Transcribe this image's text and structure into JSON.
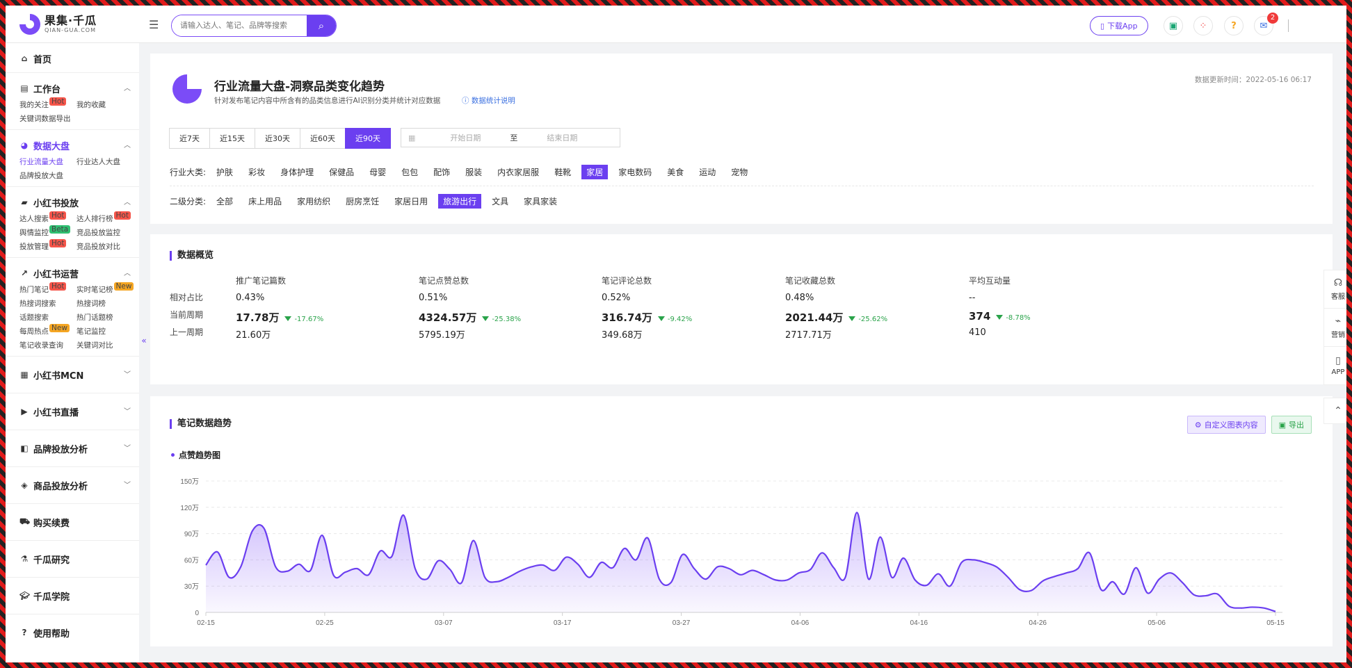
{
  "header": {
    "logo_cn": "果集·千瓜",
    "logo_en": "QIAN-GUA.COM",
    "search_placeholder": "请输入达人、笔记、品牌等搜索",
    "download_app": "下载App",
    "message_count": "2"
  },
  "sidebar": {
    "home": "首页",
    "workbench": {
      "title": "工作台",
      "items": [
        {
          "label": "我的关注",
          "tag": "Hot"
        },
        {
          "label": "我的收藏",
          "tag": ""
        },
        {
          "label": "关键词数据导出",
          "tag": ""
        }
      ]
    },
    "data_board": {
      "title": "数据大盘",
      "items": [
        {
          "label": "行业流量大盘",
          "tag": ""
        },
        {
          "label": "行业达人大盘",
          "tag": ""
        },
        {
          "label": "品牌投放大盘",
          "tag": ""
        }
      ]
    },
    "xhs_ads": {
      "title": "小红书投放",
      "items": [
        {
          "label": "达人搜索",
          "tag": "Hot"
        },
        {
          "label": "达人排行榜",
          "tag": "Hot"
        },
        {
          "label": "舆情监控",
          "tag": "Beta"
        },
        {
          "label": "竞品投放监控",
          "tag": ""
        },
        {
          "label": "投放管理",
          "tag": "Hot"
        },
        {
          "label": "竞品投放对比",
          "tag": ""
        }
      ]
    },
    "xhs_ops": {
      "title": "小红书运营",
      "items": [
        {
          "label": "热门笔记",
          "tag": "Hot"
        },
        {
          "label": "实时笔记榜",
          "tag": "New"
        },
        {
          "label": "热搜词搜索",
          "tag": ""
        },
        {
          "label": "热搜词榜",
          "tag": ""
        },
        {
          "label": "话题搜索",
          "tag": ""
        },
        {
          "label": "热门话题榜",
          "tag": ""
        },
        {
          "label": "每周热点",
          "tag": "New"
        },
        {
          "label": "笔记监控",
          "tag": ""
        },
        {
          "label": "笔记收录查询",
          "tag": ""
        },
        {
          "label": "关键词对比",
          "tag": ""
        }
      ]
    },
    "xhs_mcn": "小红书MCN",
    "xhs_live": "小红书直播",
    "brand_analysis": "品牌投放分析",
    "product_analysis": "商品投放分析",
    "purchase": "购买续费",
    "research": "千瓜研究",
    "academy": "千瓜学院",
    "help": "使用帮助"
  },
  "page": {
    "title": "行业流量大盘-洞察品类变化趋势",
    "desc": "针对发布笔记内容中所含有的品类信息进行AI识别分类并统计对应数据",
    "stat_link": "数据统计说明",
    "update_time": "数据更新时间：2022-05-16 06:17",
    "ranges": [
      "近7天",
      "近15天",
      "近30天",
      "近60天",
      "近90天"
    ],
    "active_range": "近90天",
    "date_start_placeholder": "开始日期",
    "date_to": "至",
    "date_end_placeholder": "结束日期",
    "industry_label": "行业大类:",
    "industries": [
      "护肤",
      "彩妆",
      "身体护理",
      "保健品",
      "母婴",
      "包包",
      "配饰",
      "服装",
      "内衣家居服",
      "鞋靴",
      "家居",
      "家电数码",
      "美食",
      "运动",
      "宠物"
    ],
    "active_industry": "家居",
    "sub_label": "二级分类:",
    "subs": [
      "全部",
      "床上用品",
      "家用纺织",
      "厨房烹饪",
      "家居日用",
      "旅游出行",
      "文具",
      "家具家装"
    ],
    "active_sub": "旅游出行"
  },
  "overview": {
    "title": "数据概览",
    "row_labels": [
      "相对占比",
      "当前周期",
      "上一周期"
    ],
    "columns": [
      {
        "head": "推广笔记篇数",
        "ratio": "0.43%",
        "current": "17.78万",
        "change": "-17.67%",
        "prev": "21.60万"
      },
      {
        "head": "笔记点赞总数",
        "ratio": "0.51%",
        "current": "4324.57万",
        "change": "-25.38%",
        "prev": "5795.19万"
      },
      {
        "head": "笔记评论总数",
        "ratio": "0.52%",
        "current": "316.74万",
        "change": "-9.42%",
        "prev": "349.68万"
      },
      {
        "head": "笔记收藏总数",
        "ratio": "0.48%",
        "current": "2021.44万",
        "change": "-25.62%",
        "prev": "2717.71万"
      },
      {
        "head": "平均互动量",
        "ratio": "--",
        "current": "374",
        "change": "-8.78%",
        "prev": "410"
      }
    ]
  },
  "trend": {
    "title": "笔记数据趋势",
    "custom_btn": "自定义图表内容",
    "export_btn": "导出",
    "subtitle": "点赞趋势图"
  },
  "float_bar": {
    "service": "客服",
    "marketing": "营销",
    "app": "APP"
  },
  "colors": {
    "accent": "#6b3ff0",
    "down": "#2aa34a",
    "hot": "#f5554a"
  },
  "chart_data": {
    "type": "area",
    "ylim": [
      0,
      1500000
    ],
    "yticks": [
      "0",
      "30万",
      "60万",
      "90万",
      "120万",
      "150万"
    ],
    "ytick_values": [
      0,
      300000,
      600000,
      900000,
      1200000,
      1500000
    ],
    "xticks": [
      "02-15",
      "02-25",
      "03-07",
      "03-17",
      "03-27",
      "04-06",
      "04-16",
      "04-26",
      "05-06",
      "05-15"
    ],
    "x_start": "2022-02-15",
    "x_end": "2022-05-15",
    "series": [
      {
        "values": [
          540000,
          690000,
          400000,
          520000,
          930000,
          960000,
          520000,
          470000,
          550000,
          480000,
          880000,
          420000,
          460000,
          500000,
          430000,
          700000,
          640000,
          1110000,
          500000,
          380000,
          590000,
          490000,
          340000,
          820000,
          400000,
          350000,
          400000,
          470000,
          520000,
          540000,
          480000,
          630000,
          550000,
          400000,
          570000,
          510000,
          730000,
          600000,
          850000,
          380000,
          340000,
          660000,
          500000,
          380000,
          520000,
          500000,
          430000,
          480000,
          430000,
          370000,
          370000,
          450000,
          490000,
          680000,
          510000,
          400000,
          1140000,
          380000,
          860000,
          400000,
          620000,
          370000,
          310000,
          440000,
          300000,
          570000,
          600000,
          570000,
          520000,
          400000,
          260000,
          250000,
          360000,
          410000,
          450000,
          500000,
          680000,
          260000,
          350000,
          210000,
          510000,
          220000,
          380000,
          450000,
          340000,
          200000,
          190000,
          210000,
          70000,
          50000,
          60000,
          50000,
          10000
        ]
      }
    ]
  }
}
